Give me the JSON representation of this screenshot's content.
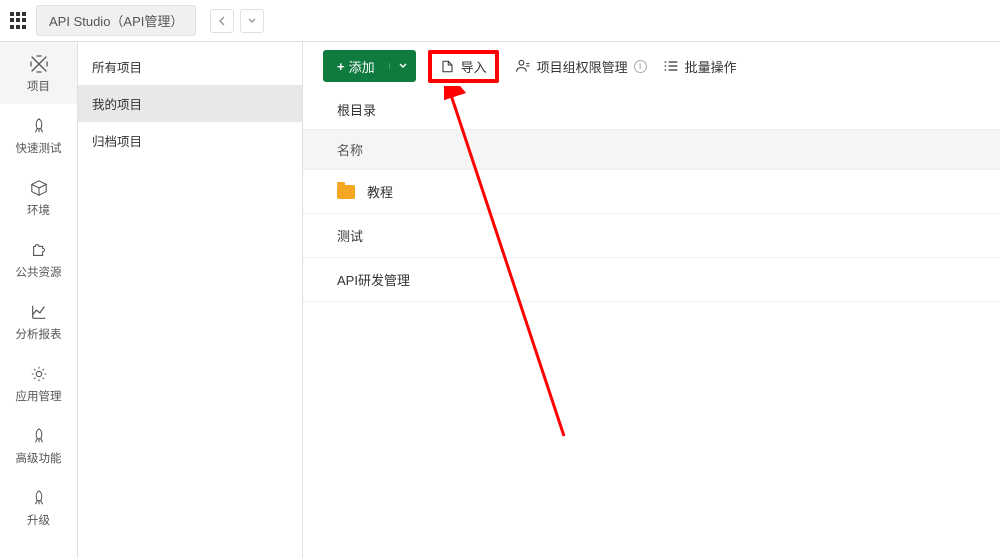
{
  "header": {
    "app_title": "API Studio（API管理）"
  },
  "sidebar_narrow": {
    "items": [
      {
        "label": "项目",
        "icon": "pencil-cross-icon",
        "active": true
      },
      {
        "label": "快速测试",
        "icon": "rocket-icon",
        "active": false
      },
      {
        "label": "环境",
        "icon": "cube-icon",
        "active": false
      },
      {
        "label": "公共资源",
        "icon": "puzzle-icon",
        "active": false
      },
      {
        "label": "分析报表",
        "icon": "chart-icon",
        "active": false
      },
      {
        "label": "应用管理",
        "icon": "gear-icon",
        "active": false
      },
      {
        "label": "高级功能",
        "icon": "rocket-icon",
        "active": false
      },
      {
        "label": "升级",
        "icon": "rocket-icon",
        "active": false
      }
    ]
  },
  "sidebar_wide": {
    "items": [
      {
        "label": "所有项目",
        "selected": false
      },
      {
        "label": "我的项目",
        "selected": true
      },
      {
        "label": "归档项目",
        "selected": false
      }
    ]
  },
  "toolbar": {
    "add_label": "添加",
    "import_label": "导入",
    "permissions_label": "项目组权限管理",
    "batch_label": "批量操作"
  },
  "main": {
    "root_label": "根目录",
    "column_header": "名称",
    "rows": [
      {
        "name": "教程",
        "is_folder": true
      },
      {
        "name": "测试",
        "is_folder": false
      },
      {
        "name": "API研发管理",
        "is_folder": false
      }
    ]
  }
}
